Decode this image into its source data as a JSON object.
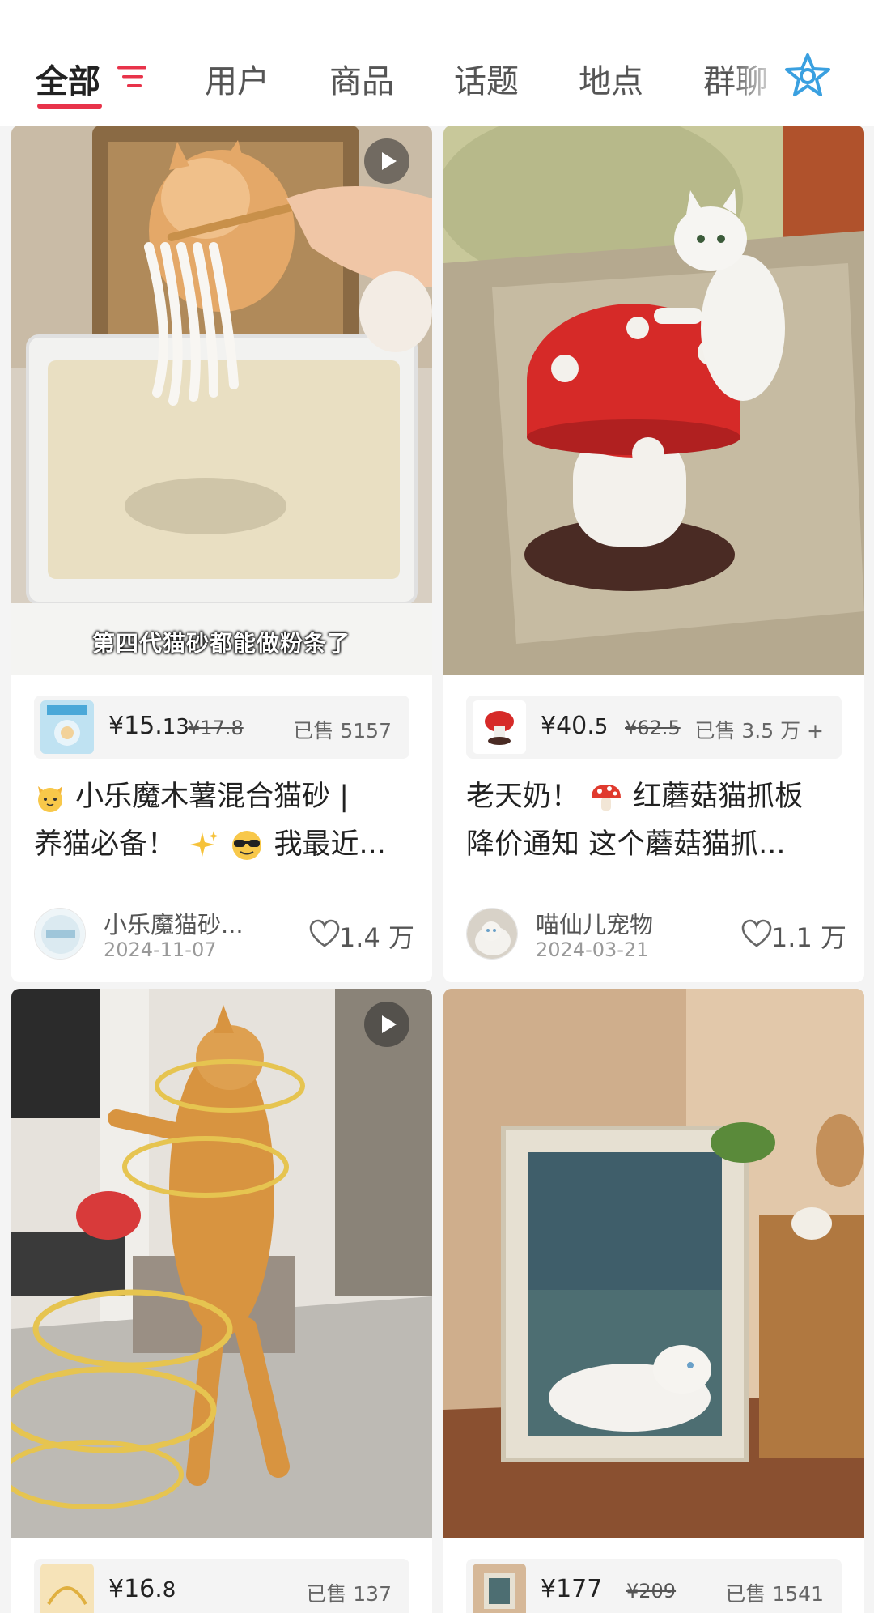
{
  "tabs": [
    {
      "label": "全部",
      "active": true
    },
    {
      "label": "用户"
    },
    {
      "label": "商品"
    },
    {
      "label": "话题"
    },
    {
      "label": "地点"
    },
    {
      "label": "群聊"
    }
  ],
  "icons": {
    "filter": "filter-icon",
    "star": "star-icon",
    "play": "play-icon",
    "heart": "heart-icon"
  },
  "accent_color": "#e8334a",
  "cards": [
    {
      "caption": "第四代猫砂都能做粉条了",
      "is_video": true,
      "product": {
        "price_int": "¥15.",
        "price_dec": "13",
        "original": "¥17.8",
        "sold": "已售 5157"
      },
      "title_line1": "小乐魔木薯混合猫砂 |",
      "title_line2": "养猫必备！",
      "title_line2_end": "我最近...",
      "author": "小乐魔猫砂...",
      "date": "2024-11-07",
      "likes": "1.4 万"
    },
    {
      "is_video": false,
      "product": {
        "price_int": "¥40.",
        "price_dec": "5",
        "original": "¥62.5",
        "sold": "已售 3.5 万 +"
      },
      "title_line1_a": "老天奶！",
      "title_line1_b": "红蘑菇猫抓板",
      "title_line2": "降价通知 这个蘑菇猫抓...",
      "author": "喵仙儿宠物",
      "date": "2024-03-21",
      "likes": "1.1 万"
    },
    {
      "is_video": true,
      "product": {
        "price_int": "¥16.",
        "price_dec": "8",
        "sold": "已售 137"
      }
    },
    {
      "is_video": false,
      "product": {
        "price_int": "¥177",
        "price_dec": "",
        "original": "¥209",
        "sold": "已售 1541"
      }
    }
  ]
}
